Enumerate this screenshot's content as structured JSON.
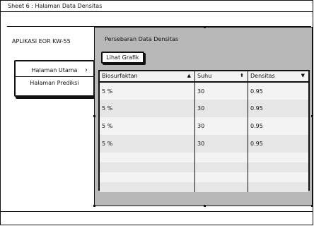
{
  "window": {
    "title": "Sheet 6 : Halaman Data Densitas"
  },
  "sidebar": {
    "app_title": "APLIKASI EOR KW-55",
    "menu_items": [
      {
        "label": "Halaman Utama"
      },
      {
        "label": "Halaman Prediksi"
      }
    ]
  },
  "panel": {
    "title": "Persebaran Data Densitas",
    "button_label": "Lihat Grafik"
  },
  "table": {
    "headers": [
      {
        "label": "Biosurfaktan",
        "sort_icon": "triangle-up-icon"
      },
      {
        "label": "Suhu",
        "sort_icon": "sort-updown-icon"
      },
      {
        "label": "Densitas",
        "sort_icon": "triangle-down-icon"
      }
    ],
    "rows": [
      [
        "5 %",
        "30",
        "0.95"
      ],
      [
        "5 %",
        "30",
        "0.95"
      ],
      [
        "5 %",
        "30",
        "0.95"
      ],
      [
        "5 %",
        "30",
        "0.95"
      ]
    ]
  }
}
